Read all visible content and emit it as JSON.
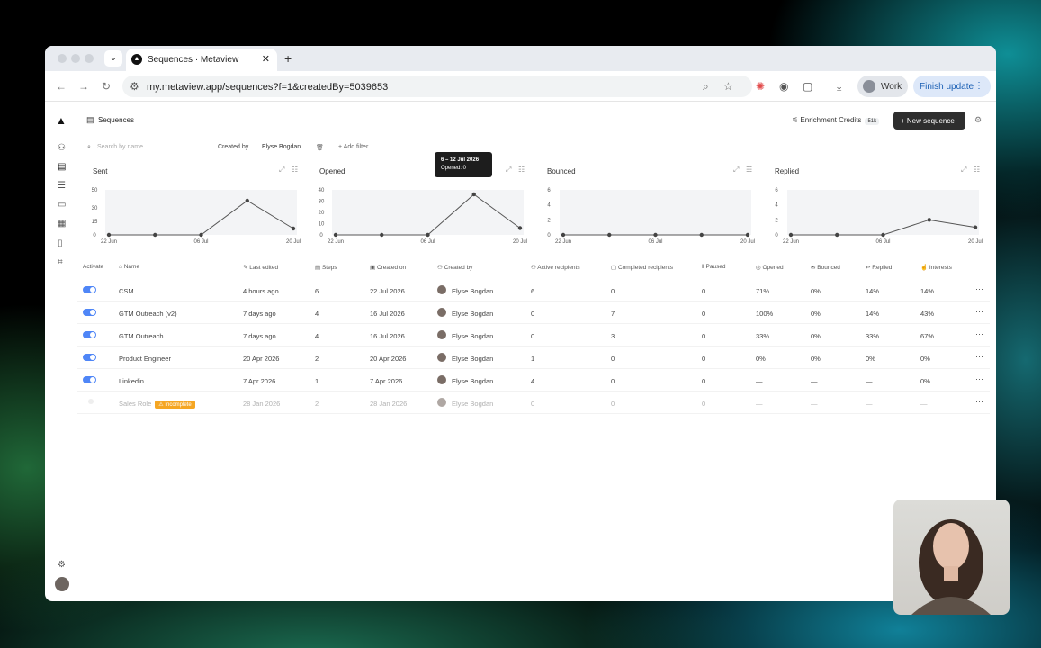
{
  "browser": {
    "tab_title": "Sequences · Metaview",
    "url": "my.metaview.app/sequences?f=1&createdBy=5039653",
    "profile_label": "Work",
    "finish_update_label": "Finish update"
  },
  "header": {
    "title": "Sequences",
    "credits_label": "Enrichment Credits",
    "credits_badge": "51k",
    "new_sequence_label": "New sequence"
  },
  "filters": {
    "search_placeholder": "Search by name",
    "created_by_label": "Created by",
    "created_by_value": "Elyse Bogdan",
    "add_filter_label": "Add filter"
  },
  "charts": [
    {
      "title": "Sent",
      "yticks": [
        "50",
        "30",
        "15",
        "0"
      ],
      "xticks": [
        "22 Jun",
        "06 Jul",
        "20 Jul"
      ]
    },
    {
      "title": "Opened",
      "yticks": [
        "40",
        "30",
        "20",
        "10",
        "0"
      ],
      "xticks": [
        "22 Jun",
        "06 Jul",
        "20 Jul"
      ]
    },
    {
      "title": "Bounced",
      "yticks": [
        "6",
        "4",
        "2",
        "0"
      ],
      "xticks": [
        "22 Jun",
        "06 Jul",
        "20 Jul"
      ]
    },
    {
      "title": "Replied",
      "yticks": [
        "6",
        "4",
        "2",
        "0"
      ],
      "xticks": [
        "22 Jun",
        "06 Jul",
        "20 Jul"
      ]
    }
  ],
  "chart_data": [
    {
      "type": "line",
      "title": "Sent",
      "x": [
        "22 Jun",
        "29 Jun",
        "06 Jul",
        "13 Jul",
        "20 Jul"
      ],
      "series": [
        {
          "values": [
            0,
            0,
            0,
            38,
            7
          ]
        }
      ],
      "ylim": [
        0,
        50
      ]
    },
    {
      "type": "line",
      "title": "Opened",
      "x": [
        "22 Jun",
        "29 Jun",
        "06 Jul",
        "13 Jul",
        "20 Jul"
      ],
      "series": [
        {
          "values": [
            0,
            0,
            0,
            36,
            6
          ]
        }
      ],
      "ylim": [
        0,
        40
      ]
    },
    {
      "type": "line",
      "title": "Bounced",
      "x": [
        "22 Jun",
        "29 Jun",
        "06 Jul",
        "13 Jul",
        "20 Jul"
      ],
      "series": [
        {
          "values": [
            0,
            0,
            0,
            0,
            0
          ]
        }
      ],
      "ylim": [
        0,
        6
      ]
    },
    {
      "type": "line",
      "title": "Replied",
      "x": [
        "22 Jun",
        "29 Jun",
        "06 Jul",
        "13 Jul",
        "20 Jul"
      ],
      "series": [
        {
          "values": [
            0,
            0,
            0,
            2,
            1
          ]
        }
      ],
      "ylim": [
        0,
        6
      ]
    }
  ],
  "tooltip": {
    "range": "6 – 12 Jul 2026",
    "text": "Opened: 0"
  },
  "table": {
    "headers": [
      "Activate",
      "Name",
      "Last edited",
      "Steps",
      "Created on",
      "Created by",
      "Active recipients",
      "Completed recipients",
      "Paused",
      "Opened",
      "Bounced",
      "Replied",
      "Interests"
    ],
    "rows": [
      {
        "name": "CSM",
        "last_edited": "4 hours ago",
        "steps": "6",
        "created_on": "22 Jul 2026",
        "created_by": "Elyse Bogdan",
        "active": "6",
        "completed": "0",
        "paused": "0",
        "opened": "71%",
        "bounced": "0%",
        "replied": "14%",
        "interests": "14%"
      },
      {
        "name": "GTM Outreach (v2)",
        "last_edited": "7 days ago",
        "steps": "4",
        "created_on": "16 Jul 2026",
        "created_by": "Elyse Bogdan",
        "active": "0",
        "completed": "7",
        "paused": "0",
        "opened": "100%",
        "bounced": "0%",
        "replied": "14%",
        "interests": "43%"
      },
      {
        "name": "GTM Outreach",
        "last_edited": "7 days ago",
        "steps": "4",
        "created_on": "16 Jul 2026",
        "created_by": "Elyse Bogdan",
        "active": "0",
        "completed": "3",
        "paused": "0",
        "opened": "33%",
        "bounced": "0%",
        "replied": "33%",
        "interests": "67%"
      },
      {
        "name": "Product Engineer",
        "last_edited": "20 Apr 2026",
        "steps": "2",
        "created_on": "20 Apr 2026",
        "created_by": "Elyse Bogdan",
        "active": "1",
        "completed": "0",
        "paused": "0",
        "opened": "0%",
        "bounced": "0%",
        "replied": "0%",
        "interests": "0%"
      },
      {
        "name": "Linkedin",
        "last_edited": "7 Apr 2026",
        "steps": "1",
        "created_on": "7 Apr 2026",
        "created_by": "Elyse Bogdan",
        "active": "4",
        "completed": "0",
        "paused": "0",
        "opened": "—",
        "bounced": "—",
        "replied": "—",
        "interests": "0%"
      },
      {
        "name": "Sales Role",
        "badge": "Incomplete",
        "last_edited": "28 Jan 2026",
        "steps": "2",
        "created_on": "28 Jan 2026",
        "created_by": "Elyse Bogdan",
        "active": "0",
        "completed": "0",
        "paused": "0",
        "opened": "—",
        "bounced": "—",
        "replied": "—",
        "interests": "—"
      }
    ]
  },
  "colors": {
    "accent": "#4f86f7",
    "button_dark": "#2e2e2e",
    "badge_orange": "#f5a623"
  }
}
